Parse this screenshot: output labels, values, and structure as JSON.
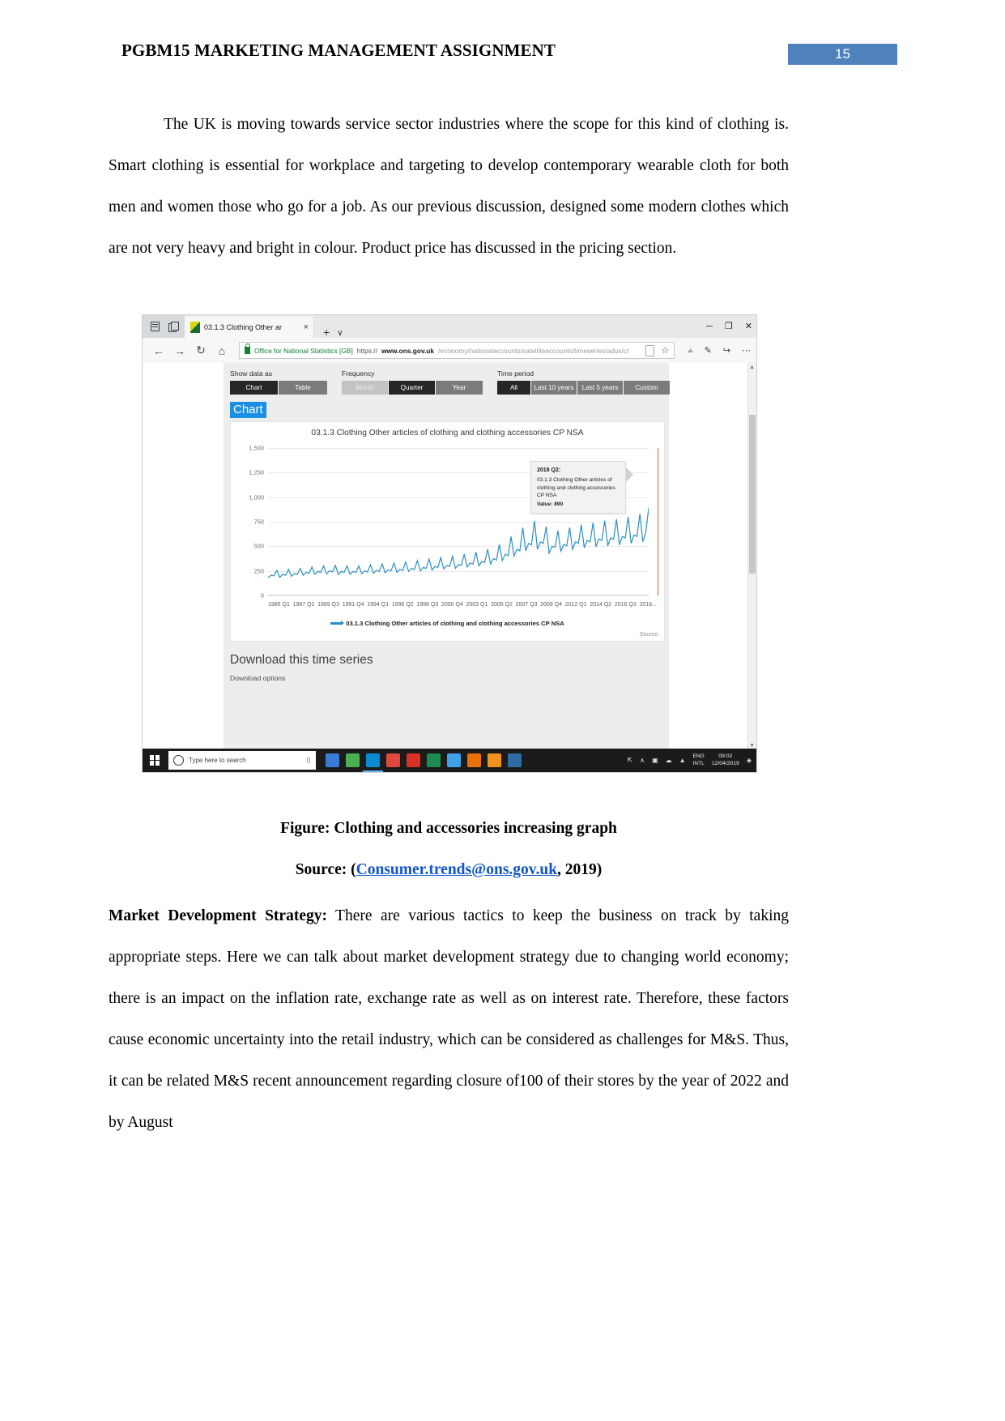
{
  "header": {
    "title": "PGBM15 MARKETING MANAGEMENT ASSIGNMENT",
    "page_number": "15",
    "badge_color": "#4f81bd"
  },
  "body": {
    "paragraph_top": "The UK is moving towards service sector industries where the scope for this kind of clothing is. Smart clothing is essential for workplace and targeting to develop contemporary wearable cloth for both men and women those who go for a job. As our previous discussion, designed some modern clothes which are not very heavy and bright in colour. Product price has discussed in the pricing section.",
    "paragraph_bottom_lead": "Market Development Strategy:",
    "paragraph_bottom": " There are various tactics to keep the business on track by taking appropriate steps. Here we can talk about market development strategy due to changing world economy; there is an impact on the inflation rate, exchange rate as well as on interest rate. Therefore, these factors cause economic uncertainty into the retail industry, which can be considered as challenges for M&S. Thus, it can be related M&S recent announcement regarding closure of100 of their stores by the year of 2022 and by August"
  },
  "caption": {
    "figure": "Figure: Clothing and accessories increasing graph",
    "source_prefix": "Source: (",
    "source_link": "Consumer.trends@ons.gov.uk",
    "source_suffix": ", 2019)"
  },
  "browser": {
    "tab": {
      "title": "03.1.3 Clothing Other ar",
      "close": "×",
      "new_tab": "+",
      "dropdown": "∨"
    },
    "window_controls": {
      "minimize": "─",
      "maximize": "❐",
      "close": "✕"
    },
    "nav": {
      "back": "←",
      "forward": "→",
      "refresh": "↻",
      "home": "⌂"
    },
    "url": {
      "organisation": "Office for National Statistics [GB]",
      "scheme": "https://",
      "domain": "www.ons.gov.uk",
      "path": "/economy/nationalaccounts/satelliteaccounts/timeseries/adus/ct"
    },
    "url_actions": {
      "reader": "reading-view-icon",
      "favourite": "☆"
    },
    "toolbar_icons": [
      "hub-icon",
      "notes-icon",
      "share-icon",
      "more-icon"
    ],
    "toolbar_glyphs": [
      "⫨",
      "✎",
      "↪",
      "⋯"
    ]
  },
  "page_content": {
    "controls": [
      {
        "label": "Show data as",
        "options": [
          {
            "text": "Chart",
            "state": "active"
          },
          {
            "text": "Table",
            "state": "normal"
          }
        ]
      },
      {
        "label": "Frequency",
        "options": [
          {
            "text": "Month",
            "state": "disabled"
          },
          {
            "text": "Quarter",
            "state": "active"
          },
          {
            "text": "Year",
            "state": "normal"
          }
        ]
      },
      {
        "label": "Time period",
        "options": [
          {
            "text": "All",
            "state": "active"
          },
          {
            "text": "Last 10 years",
            "state": "normal"
          },
          {
            "text": "Last 5 years",
            "state": "normal"
          },
          {
            "text": "Custom",
            "state": "normal"
          }
        ]
      }
    ],
    "chart_heading": "Chart",
    "download_title": "Download this time series",
    "download_sub": "Download options",
    "source_note": "Source:"
  },
  "tooltip": {
    "period": "2018 Q2:",
    "series": "03.1.3 Clothing Other articles of clothing and clothing accessories CP NSA",
    "value": "Value: 890"
  },
  "chart_data": {
    "type": "line",
    "title": "03.1.3 Clothing Other articles of clothing and clothing accessories CP NSA",
    "xlabel": "",
    "ylabel": "",
    "ylim": [
      0,
      1500
    ],
    "yticks": [
      "0",
      "250",
      "500",
      "750",
      "1,000",
      "1,250",
      "1,500"
    ],
    "grid": true,
    "legend_position": "bottom",
    "legend": [
      "03.1.3 Clothing Other articles of clothing and clothing accessories CP NSA"
    ],
    "series_color": "#2b8fc4",
    "marker_color": "#e2600f",
    "xticks": [
      "1985 Q1",
      "1987 Q2",
      "1989 Q3",
      "1991 Q4",
      "1994 Q1",
      "1996 Q2",
      "1998 Q3",
      "2000 Q4",
      "2003 Q1",
      "2005 Q2",
      "2007 Q3",
      "2009 Q4",
      "2012 Q1",
      "2014 Q2",
      "2016 Q3",
      "2018..."
    ],
    "annotations": [
      {
        "x": "2018 Q2",
        "value": 890,
        "label": "Value: 890"
      }
    ],
    "x": [
      "1985 Q1",
      "1985 Q2",
      "1985 Q3",
      "1985 Q4",
      "1986 Q1",
      "1986 Q2",
      "1986 Q3",
      "1986 Q4",
      "1987 Q1",
      "1987 Q2",
      "1987 Q3",
      "1987 Q4",
      "1988 Q1",
      "1988 Q2",
      "1988 Q3",
      "1988 Q4",
      "1989 Q1",
      "1989 Q2",
      "1989 Q3",
      "1989 Q4",
      "1990 Q1",
      "1990 Q2",
      "1990 Q3",
      "1990 Q4",
      "1991 Q1",
      "1991 Q2",
      "1991 Q3",
      "1991 Q4",
      "1992 Q1",
      "1992 Q2",
      "1992 Q3",
      "1992 Q4",
      "1993 Q1",
      "1993 Q2",
      "1993 Q3",
      "1993 Q4",
      "1994 Q1",
      "1994 Q2",
      "1994 Q3",
      "1994 Q4",
      "1995 Q1",
      "1995 Q2",
      "1995 Q3",
      "1995 Q4",
      "1996 Q1",
      "1996 Q2",
      "1996 Q3",
      "1996 Q4",
      "1997 Q1",
      "1997 Q2",
      "1997 Q3",
      "1997 Q4",
      "1998 Q1",
      "1998 Q2",
      "1998 Q3",
      "1998 Q4",
      "1999 Q1",
      "1999 Q2",
      "1999 Q3",
      "1999 Q4",
      "2000 Q1",
      "2000 Q2",
      "2000 Q3",
      "2000 Q4",
      "2001 Q1",
      "2001 Q2",
      "2001 Q3",
      "2001 Q4",
      "2002 Q1",
      "2002 Q2",
      "2002 Q3",
      "2002 Q4",
      "2003 Q1",
      "2003 Q2",
      "2003 Q3",
      "2003 Q4",
      "2004 Q1",
      "2004 Q2",
      "2004 Q3",
      "2004 Q4",
      "2005 Q1",
      "2005 Q2",
      "2005 Q3",
      "2005 Q4",
      "2006 Q1",
      "2006 Q2",
      "2006 Q3",
      "2006 Q4",
      "2007 Q1",
      "2007 Q2",
      "2007 Q3",
      "2007 Q4",
      "2008 Q1",
      "2008 Q2",
      "2008 Q3",
      "2008 Q4",
      "2009 Q1",
      "2009 Q2",
      "2009 Q3",
      "2009 Q4",
      "2010 Q1",
      "2010 Q2",
      "2010 Q3",
      "2010 Q4",
      "2011 Q1",
      "2011 Q2",
      "2011 Q3",
      "2011 Q4",
      "2012 Q1",
      "2012 Q2",
      "2012 Q3",
      "2012 Q4",
      "2013 Q1",
      "2013 Q2",
      "2013 Q3",
      "2013 Q4",
      "2014 Q1",
      "2014 Q2",
      "2014 Q3",
      "2014 Q4",
      "2015 Q1",
      "2015 Q2",
      "2015 Q3",
      "2015 Q4",
      "2016 Q1",
      "2016 Q2",
      "2016 Q3",
      "2016 Q4",
      "2017 Q1",
      "2017 Q2",
      "2017 Q3",
      "2017 Q4",
      "2018 Q1",
      "2018 Q2"
    ],
    "values": [
      180,
      205,
      200,
      255,
      185,
      215,
      205,
      265,
      195,
      225,
      215,
      275,
      205,
      235,
      225,
      290,
      215,
      245,
      235,
      300,
      220,
      250,
      240,
      305,
      215,
      245,
      235,
      300,
      215,
      245,
      235,
      300,
      220,
      250,
      240,
      310,
      225,
      255,
      245,
      320,
      230,
      260,
      250,
      330,
      235,
      265,
      255,
      340,
      245,
      275,
      265,
      355,
      250,
      285,
      275,
      370,
      260,
      295,
      285,
      385,
      270,
      305,
      295,
      400,
      275,
      315,
      305,
      420,
      290,
      330,
      320,
      440,
      300,
      345,
      335,
      470,
      320,
      375,
      360,
      520,
      355,
      420,
      405,
      600,
      400,
      470,
      455,
      690,
      455,
      530,
      515,
      760,
      470,
      545,
      530,
      700,
      430,
      500,
      490,
      660,
      450,
      520,
      505,
      690,
      470,
      545,
      530,
      720,
      485,
      560,
      545,
      740,
      495,
      575,
      560,
      760,
      505,
      585,
      570,
      775,
      515,
      600,
      585,
      800,
      530,
      615,
      600,
      830,
      545,
      640,
      890
    ]
  },
  "taskbar": {
    "search_placeholder": "Type here to search",
    "language": [
      "ENG",
      "INTL"
    ],
    "time": "09:02",
    "date": "12/04/2019",
    "tray_glyphs": [
      "⇱",
      "∧",
      "▣",
      "☁",
      "▲",
      "◈"
    ],
    "app_colors": [
      "#3a7bd5",
      "#4caf50",
      "#0a8ad1",
      "#e0483b",
      "#d93025",
      "#1d8a4f",
      "#3fa0e8",
      "#e8710a",
      "#f0921c",
      "#2e6da4"
    ]
  }
}
